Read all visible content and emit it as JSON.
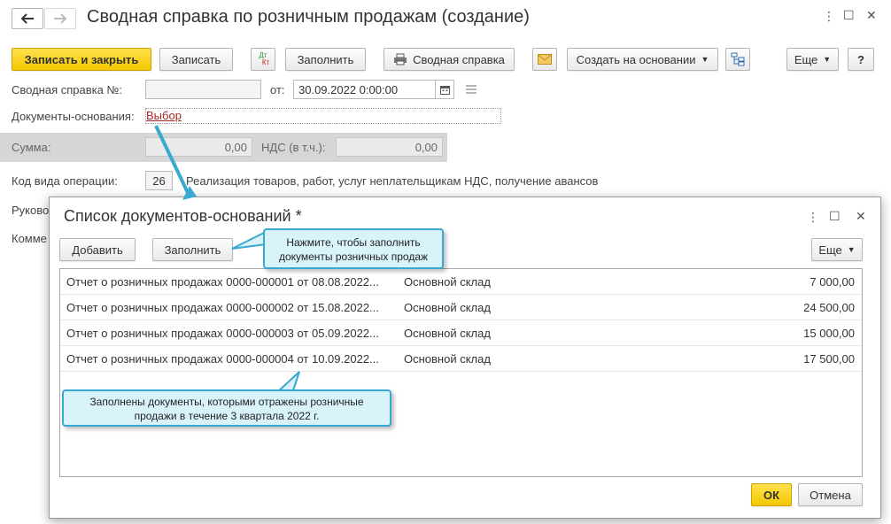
{
  "main": {
    "title": "Сводная справка по розничным продажам (создание)",
    "toolbar": {
      "save_close": "Записать и закрыть",
      "save": "Записать",
      "dtkt_top": "Дт",
      "dtkt_bottom": "Кт",
      "fill": "Заполнить",
      "summary": "Сводная справка",
      "create_based": "Создать на основании",
      "more": "Еще",
      "help": "?"
    },
    "form": {
      "number_label": "Сводная справка №:",
      "number_value": "",
      "from_label": "от:",
      "date_value": "30.09.2022  0:00:00",
      "docs_label": "Документы-основания:",
      "docs_link": "Выбор",
      "sum_label": "Сумма:",
      "sum_value": "0,00",
      "vat_label": "НДС (в т.ч.):",
      "vat_value": "0,00",
      "opcode_label": "Код вида операции:",
      "opcode_value": "26",
      "opcode_desc": "Реализация товаров, работ, услуг неплательщикам НДС, получение авансов",
      "head_label": "Руково",
      "comment_label": "Комме"
    }
  },
  "dialog": {
    "title": "Список документов-оснований *",
    "add": "Добавить",
    "fill": "Заполнить",
    "more": "Еще",
    "ok": "ОК",
    "cancel": "Отмена",
    "rows": [
      {
        "doc": "Отчет о розничных продажах 0000-000001 от 08.08.2022...",
        "warehouse": "Основной склад",
        "amount": "7 000,00"
      },
      {
        "doc": "Отчет о розничных продажах 0000-000002 от 15.08.2022...",
        "warehouse": "Основной склад",
        "amount": "24 500,00"
      },
      {
        "doc": "Отчет о розничных продажах 0000-000003 от 05.09.2022...",
        "warehouse": "Основной склад",
        "amount": "15 000,00"
      },
      {
        "doc": "Отчет о розничных продажах 0000-000004 от 10.09.2022...",
        "warehouse": "Основной склад",
        "amount": "17 500,00"
      }
    ]
  },
  "callouts": {
    "fill_hint": "Нажмите, чтобы заполнить документы розничных продаж",
    "filled_hint": "Заполнены документы, которыми отражены розничные продажи в течение 3 квартала 2022 г."
  },
  "colors": {
    "accent_yellow": "#f4c800",
    "callout_border": "#3aa9cf",
    "callout_bg": "#d9f3fb",
    "link_red": "#a52a2a"
  }
}
